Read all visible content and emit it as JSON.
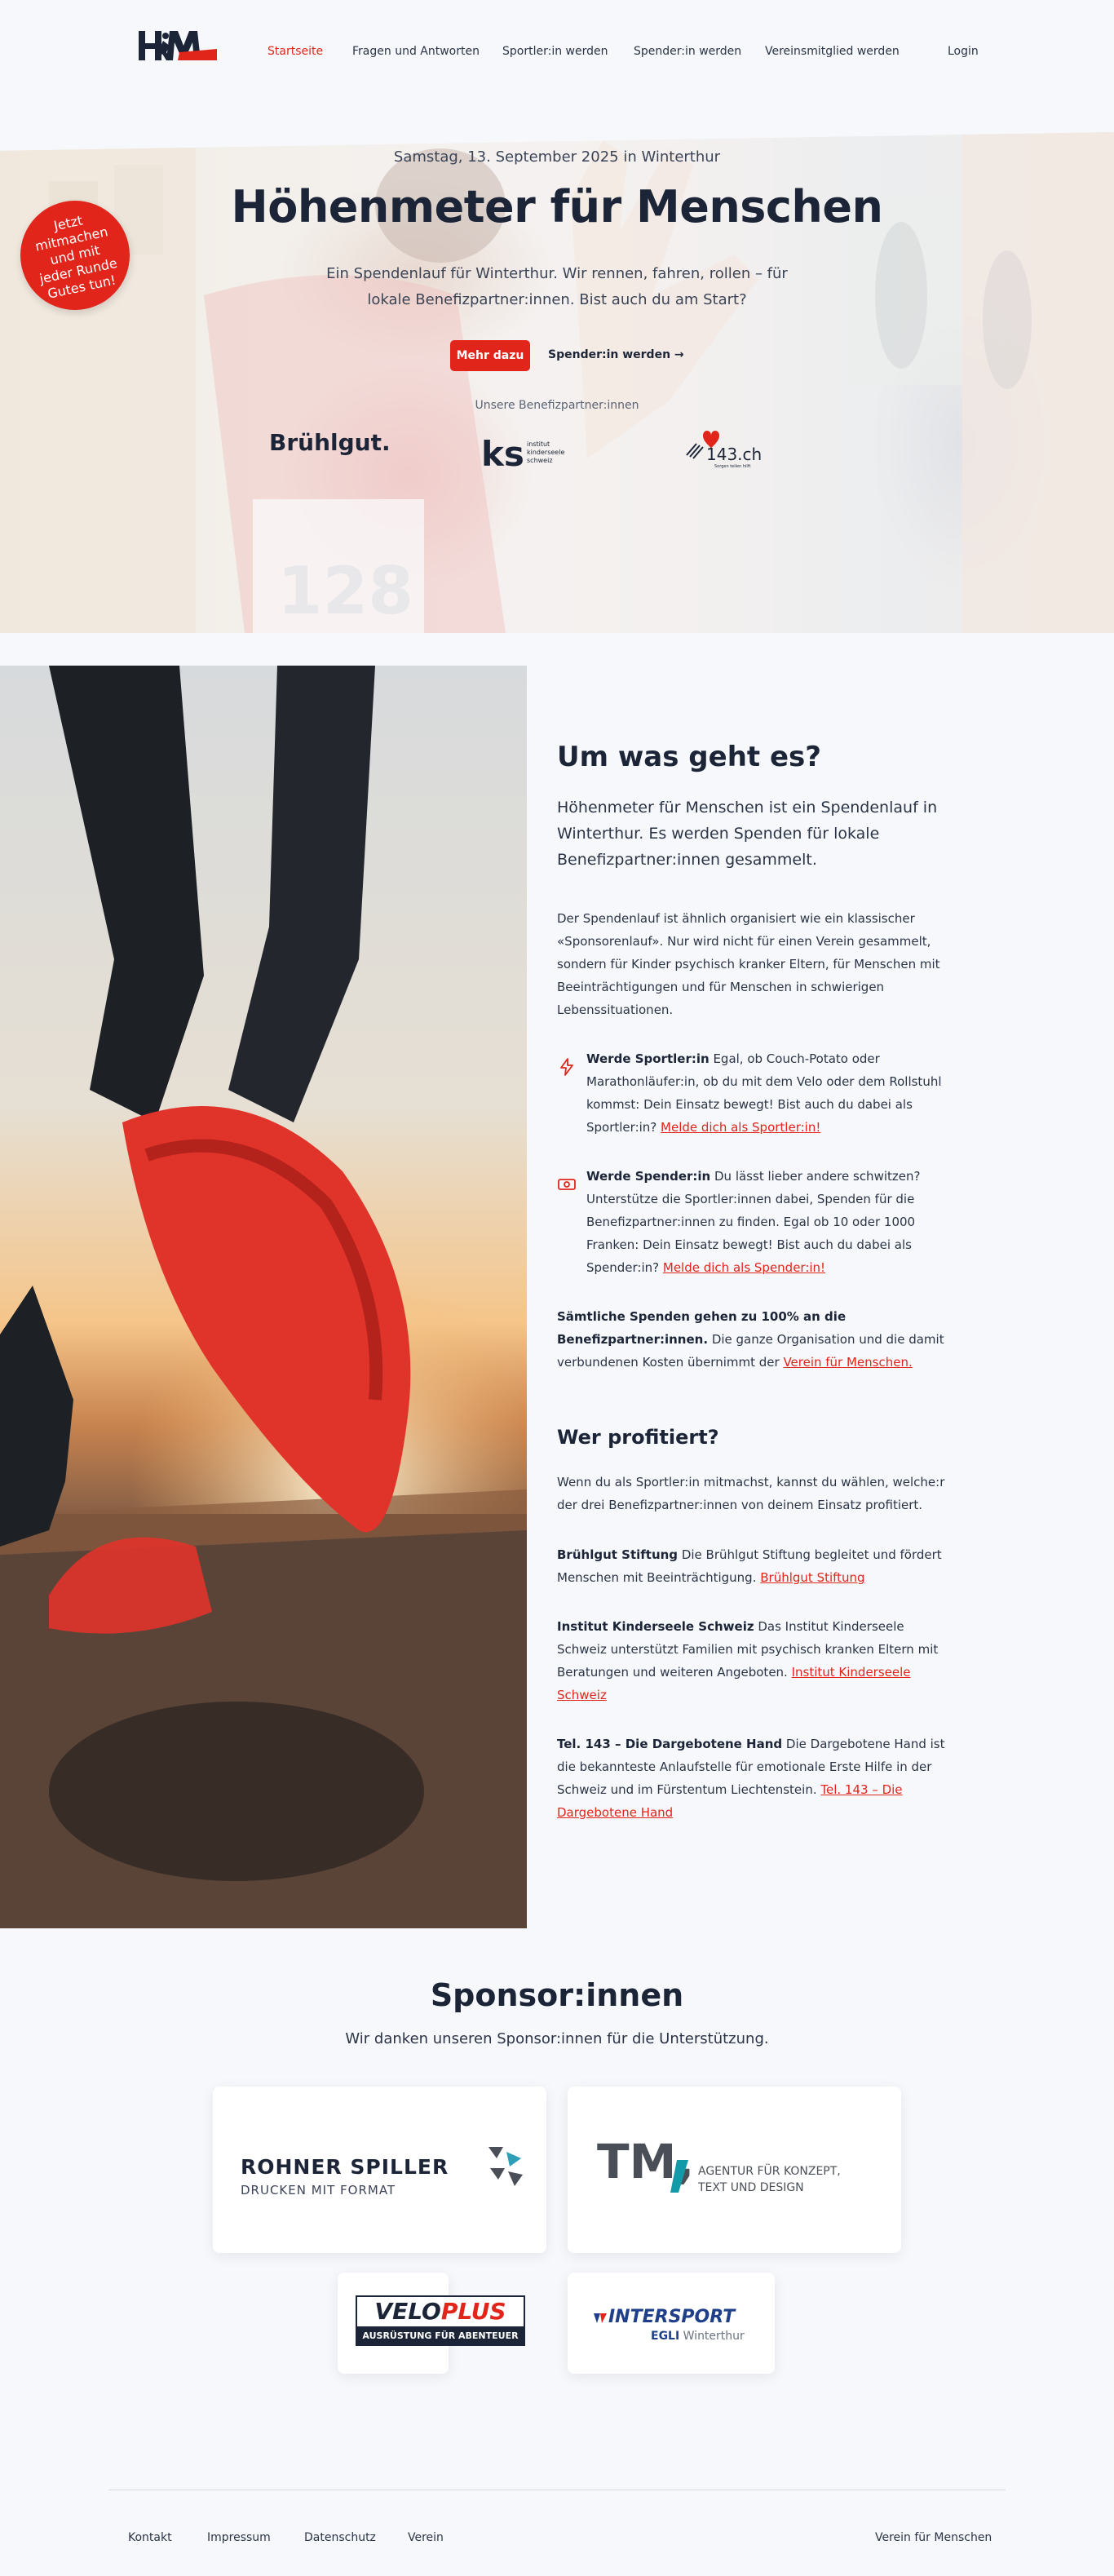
{
  "brand": {
    "logo_text": "H&M",
    "accent_color": "#e1251b",
    "dark_color": "#1c2537"
  },
  "nav": {
    "items": [
      {
        "label": "Startseite",
        "active": true
      },
      {
        "label": "Fragen und Antworten"
      },
      {
        "label": "Sportler:in werden"
      },
      {
        "label": "Spender:in werden"
      },
      {
        "label": "Vereinsmitglied werden"
      }
    ],
    "login": "Login"
  },
  "hero": {
    "date": "Samstag, 13. September 2025 in Winterthur",
    "title": "Höhenmeter für Menschen",
    "lead": "Ein Spendenlauf für Winterthur. Wir rennen, fahren, rollen – für lokale Benefizpartner:innen. Bist auch du am Start?",
    "cta": "Mehr dazu",
    "secondary": "Spender:in werden →",
    "partners_label": "Unsere Benefizpartner:innen",
    "partners": [
      "Brühlgut.",
      "institut kinderseele schweiz",
      "143.ch"
    ],
    "partner_logos": {
      "ks_mark": "ks",
      "ks_line1": "institut",
      "ks_line2": "kinderseele",
      "ks_line3": "schweiz",
      "tel_mark": "143.ch",
      "tel_sub": "Sorgen teilen hilft"
    },
    "badge": "Jetzt mitmachen und mit jeder Runde Gutes tun!"
  },
  "about": {
    "title": "Um was geht es?",
    "lead": "Höhenmeter für Menschen ist ein Spendenlauf in Winterthur. Es werden Spenden für lokale Benefizpartner:innen gesammelt.",
    "body": "Der Spendenlauf ist ähnlich organisiert wie ein klassischer «Sponsorenlauf». Nur wird nicht für einen Verein gesammelt, sondern für Kinder psychisch kranker Eltern, für Menschen mit Beeinträchtigungen und für Menschen in schwierigen Lebenssituationen.",
    "features": [
      {
        "icon": "lightning-icon",
        "title": "Werde Sportler:in",
        "text": " Egal, ob Couch-Potato oder Marathonläufer:in, ob du mit dem Velo oder dem Rollstuhl kommst: Dein Einsatz bewegt! Bist auch du dabei als Sportler:in? ",
        "link": "Melde dich als Sportler:in!"
      },
      {
        "icon": "money-icon",
        "title": "Werde Spender:in",
        "text": " Du lässt lieber andere schwitzen? Unterstütze die Sportler:innen dabei, Spenden für die Benefizpartner:innen zu finden. Egal ob 10 oder 1000 Franken: Dein Einsatz bewegt! Bist auch du dabei als Spender:in? ",
        "link": "Melde dich als Spender:in!"
      }
    ],
    "donation_bold": "Sämtliche Spenden gehen zu 100% an die Benefizpartner:innen.",
    "donation_text": " Die ganze Organisation und die damit verbundenen Kosten übernimmt der ",
    "donation_link": "Verein für Menschen."
  },
  "beneficiaries": {
    "title": "Wer profitiert?",
    "intro": "Wenn du als Sportler:in mitmachst, kannst du wählen, welche:r der drei Benefizpartner:innen von deinem Einsatz profitiert.",
    "items": [
      {
        "name": "Brühlgut Stiftung",
        "text": " Die Brühlgut Stiftung begleitet und fördert Menschen mit Beeinträchtigung. ",
        "link": "Brühlgut Stiftung"
      },
      {
        "name": "Institut Kinderseele Schweiz",
        "text": " Das Institut Kinderseele Schweiz unterstützt Familien mit psychisch kranken Eltern mit Beratungen und weiteren Angeboten. ",
        "link": "Institut Kinderseele Schweiz"
      },
      {
        "name": "Tel. 143 – Die Dargebotene Hand",
        "text": " Die Dargebotene Hand ist die bekannteste Anlaufstelle für emotionale Erste Hilfe in der Schweiz und im Fürstentum Liechtenstein. ",
        "link": "Tel. 143 – Die Dargebotene Hand"
      }
    ]
  },
  "sponsors": {
    "title": "Sponsor:innen",
    "subtitle": "Wir danken unseren Sponsor:innen für die Unterstützung.",
    "items": [
      {
        "name": "ROHNER SPILLER",
        "tagline": "DRUCKEN MIT FORMAT"
      },
      {
        "name": "TM,",
        "tagline": "AGENTUR FÜR KONZEPT, TEXT UND DESIGN",
        "tagline_line1": "AGENTUR FÜR KONZEPT,",
        "tagline_line2": "TEXT UND DESIGN"
      },
      {
        "name": "VELOPLUS",
        "name_part1": "VELO",
        "name_part2": "PLUS",
        "tagline": "AUSRÜSTUNG FÜR ABENTEUER"
      },
      {
        "name": "INTERSPORT",
        "tagline": "EGLI Winterthur",
        "tagline_bold": "EGLI",
        "tagline_rest": " Winterthur"
      }
    ]
  },
  "footer": {
    "links": [
      "Kontakt",
      "Impressum",
      "Datenschutz",
      "Verein"
    ],
    "org": "Verein für Menschen"
  }
}
